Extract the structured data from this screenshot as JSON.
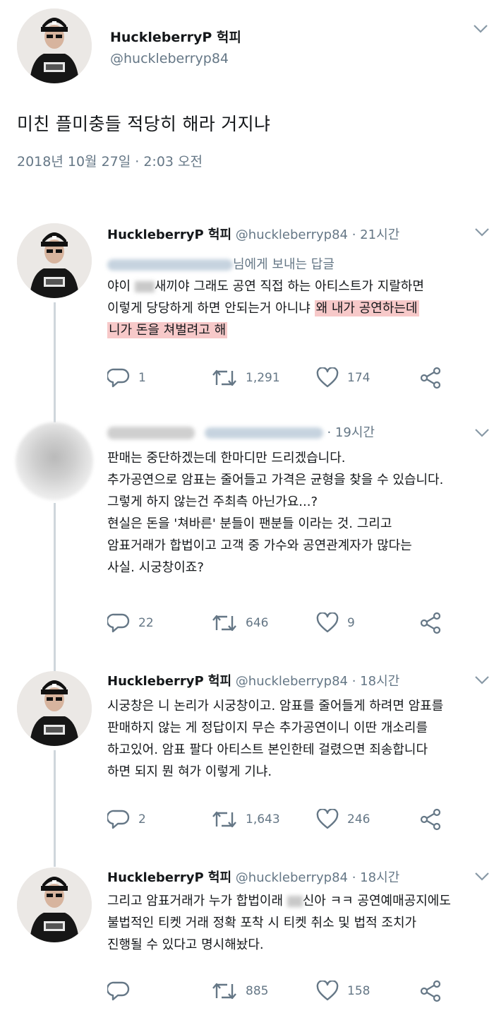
{
  "main_tweet": {
    "name": "HuckleberryP 헉피",
    "handle": "@huckleberryp84",
    "text": "미친 플미충들 적당히 해라 거지냐",
    "timestamp": "2018년 10월 27일 · 2:03 오전"
  },
  "replies": [
    {
      "name": "HuckleberryP 헉피",
      "handle": "@huckleberryp84",
      "time": "· 21시간",
      "reply_to": "님에게 보내는 답글",
      "lines": [
        {
          "a": "야이 ",
          "b": "새끼야 그래도 공연 직접 하는 아티스트가 지랄하면"
        },
        {
          "a": "이렇게 당당하게 하면 안되는거 아니냐 ",
          "hl": "왜 내가 공연하는데"
        },
        {
          "hl": "니가 돈을 쳐벌려고 해"
        }
      ],
      "stats": {
        "replies": "1",
        "retweets": "1,291",
        "likes": "174"
      }
    },
    {
      "time": "· 19시간",
      "lines": [
        "판매는 중단하겠는데 한마디만 드리겠습니다.",
        "추가공연으로 암표는 줄어들고 가격은 균형을 찾을 수 있습니다.",
        "그렇게 하지 않는건 주최측 아닌가요...?",
        "현실은 돈을 '쳐바른' 분들이 팬분들 이라는 것. 그리고",
        "암표거래가 합법이고 고객 중 가수와 공연관계자가 많다는",
        "사실. 시궁창이죠?"
      ],
      "stats": {
        "replies": "22",
        "retweets": "646",
        "likes": "9"
      }
    },
    {
      "name": "HuckleberryP 헉피",
      "handle": "@huckleberryp84",
      "time": "· 18시간",
      "lines": [
        "시궁창은 니 논리가 시궁창이고. 암표를 줄어들게 하려면 암표를",
        "판매하지 않는 게 정답이지 무슨 추가공연이니 이딴 개소리를",
        "하고있어. 암표 팔다 아티스트 본인한테 걸렸으면 죄송합니다",
        "하면 되지 뭔 혀가 이렇게 기냐."
      ],
      "stats": {
        "replies": "2",
        "retweets": "1,643",
        "likes": "246"
      }
    },
    {
      "name": "HuckleberryP 헉피",
      "handle": "@huckleberryp84",
      "time": "· 18시간",
      "lines": [
        {
          "a": "그리고 암표거래가 누가 합법이래 ",
          "b": "신아 ㅋㅋ 공연예매공지에도"
        },
        {
          "a": "불법적인 티켓 거래 정확 포착 시 티켓 취소 및 법적 조치가"
        },
        {
          "a": "진행될 수 있다고 명시해놨다."
        }
      ],
      "stats": {
        "replies": "",
        "retweets": "885",
        "likes": "158"
      }
    }
  ],
  "icons": {
    "reply": "reply-icon",
    "retweet": "retweet-icon",
    "like": "heart-icon",
    "share": "share-icon",
    "more": "chevron-down-icon"
  },
  "colors": {
    "highlight": "#f7c9c9",
    "secondary_text": "#657786",
    "thread_line": "#cfd6dc"
  }
}
